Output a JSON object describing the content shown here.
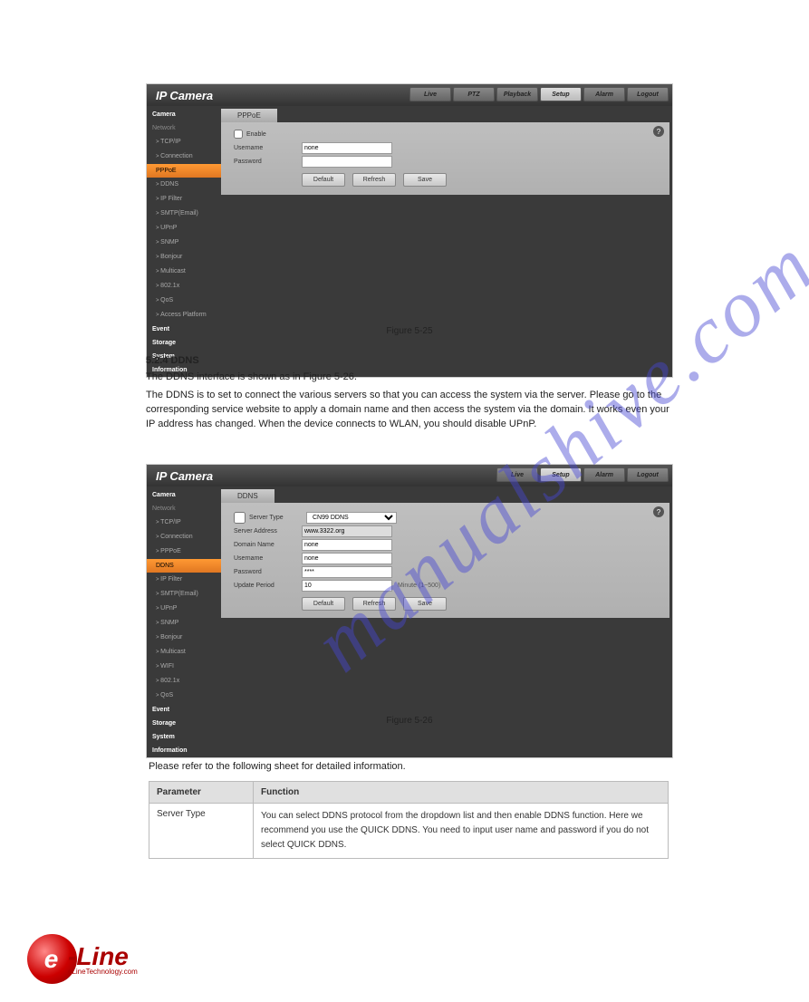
{
  "product_title": "IP Camera",
  "nav": {
    "live": "Live",
    "ptz": "PTZ",
    "playback": "Playback",
    "setup": "Setup",
    "alarm": "Alarm",
    "logout": "Logout"
  },
  "sidebar": {
    "camera": "Camera",
    "network": "Network",
    "tcpip": "TCP/IP",
    "connection": "Connection",
    "pppoe": "PPPoE",
    "ddns": "DDNS",
    "ipfilter": "IP Filter",
    "smtp": "SMTP(Email)",
    "upnp": "UPnP",
    "snmp": "SNMP",
    "bonjour": "Bonjour",
    "multicast": "Multicast",
    "wifi": "WIFI",
    "8021x": "802.1x",
    "qos": "QoS",
    "access": "Access Platform",
    "event": "Event",
    "storage": "Storage",
    "system": "System",
    "information": "Information"
  },
  "pppoe_tab": "PPPoE",
  "enable_label": "Enable",
  "username_label": "Username",
  "password_label": "Password",
  "username_val": "none",
  "btn_default": "Default",
  "btn_refresh": "Refresh",
  "btn_save": "Save",
  "ddns_tab": "DDNS",
  "server_type_label": "Server Type",
  "server_type_val": "CN99 DDNS",
  "server_addr_label": "Server Address",
  "server_addr_val": "www.3322.org",
  "domain_label": "Domain Name",
  "domain_val": "none",
  "username2_val": "none",
  "password_val": "****",
  "update_label": "Update Period",
  "update_val": "10",
  "update_hint": "Minute (1~500)",
  "fig1": "Figure 5-25",
  "section_ddns_title": "5.2.4 DDNS",
  "ddns_para": "The DDNS interface is shown as in Figure 5-26.",
  "ddns_note": "The DDNS is to set to connect the various servers so that you can access the system via the server. Please go to the corresponding service website to apply a domain name and then access the system via the domain. It works even your IP address has changed. When the device connects to WLAN, you should disable UPnP.",
  "fig2": "Figure 5-26",
  "ddns_table_intro": "Please refer to the following sheet for detailed information.",
  "table": {
    "h1": "Parameter",
    "h2": "Function",
    "r1p": "Server Type",
    "r1f": "You can select DDNS protocol from the dropdown list and then enable DDNS function. Here we recommend you use the QUICK DDNS. You need to input user name and password if you do not select QUICK DDNS."
  },
  "help_symbol": "?",
  "watermark_text": "manualshive.com",
  "logo_text": "-Line",
  "logo_sub": "eLineTechnology.com"
}
